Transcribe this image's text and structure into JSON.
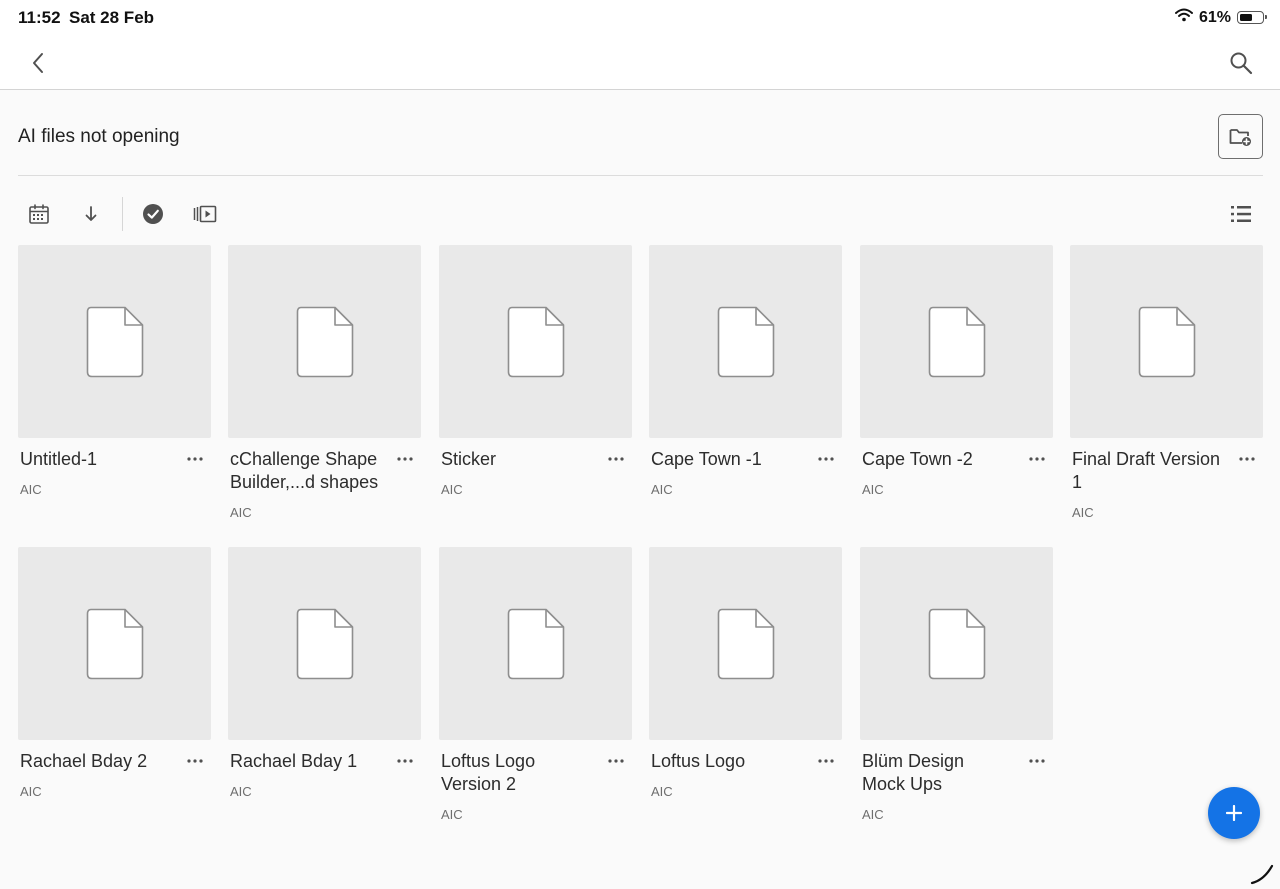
{
  "status": {
    "time": "11:52",
    "date": "Sat 28 Feb",
    "battery_pct": "61%",
    "battery_level": 0.61
  },
  "nav": {
    "back_icon": "chevron-left-icon",
    "search_icon": "search-icon"
  },
  "folder": {
    "title": "AI files not opening",
    "new_folder_icon": "folder-add-icon"
  },
  "toolbar": {
    "icons": [
      "calendar-icon",
      "sort-down-icon",
      "select-check-icon",
      "slideshow-icon",
      "list-view-icon"
    ]
  },
  "files": [
    {
      "name": "Untitled-1",
      "type": "AIC"
    },
    {
      "name": "cChallenge Shape Builder,...d shapes",
      "type": "AIC"
    },
    {
      "name": "Sticker",
      "type": "AIC"
    },
    {
      "name": "Cape Town -1",
      "type": "AIC"
    },
    {
      "name": "Cape Town -2",
      "type": "AIC"
    },
    {
      "name": "Final Draft Version 1",
      "type": "AIC"
    },
    {
      "name": "Rachael Bday 2",
      "type": "AIC"
    },
    {
      "name": "Rachael Bday 1",
      "type": "AIC"
    },
    {
      "name": "Loftus Logo Version 2",
      "type": "AIC"
    },
    {
      "name": "Loftus Logo",
      "type": "AIC"
    },
    {
      "name": "Blüm Design Mock Ups",
      "type": "AIC"
    }
  ],
  "fab": {
    "label": "+",
    "color": "#1473e6"
  }
}
